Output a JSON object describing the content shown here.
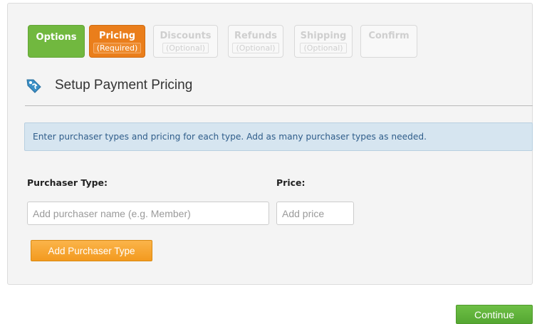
{
  "steps": [
    {
      "label": "Options",
      "sub": ""
    },
    {
      "label": "Pricing",
      "sub": "(Required)"
    },
    {
      "label": "Discounts",
      "sub": "(Optional)"
    },
    {
      "label": "Refunds",
      "sub": "(Optional)"
    },
    {
      "label": "Shipping",
      "sub": "(Optional)"
    },
    {
      "label": "Confirm",
      "sub": ""
    }
  ],
  "section": {
    "title": "Setup Payment Pricing",
    "icon": "price-tag-icon"
  },
  "info_text": "Enter purchaser types and pricing for each type. Add as many purchaser types as needed.",
  "form": {
    "purchaser_label": "Purchaser Type:",
    "price_label": "Price:",
    "purchaser_input": {
      "value": "",
      "placeholder": "Add purchaser name (e.g. Member)"
    },
    "price_input": {
      "value": "",
      "placeholder": "Add price"
    },
    "add_button": "Add Purchaser Type"
  },
  "continue_button": "Continue",
  "colors": {
    "step_done": "#71b83f",
    "step_active": "#ea7e1b",
    "info_bg": "#d6e5f0",
    "info_text": "#2f5d8a",
    "add_button": "#f5a12a",
    "continue_button": "#5cb13a"
  }
}
